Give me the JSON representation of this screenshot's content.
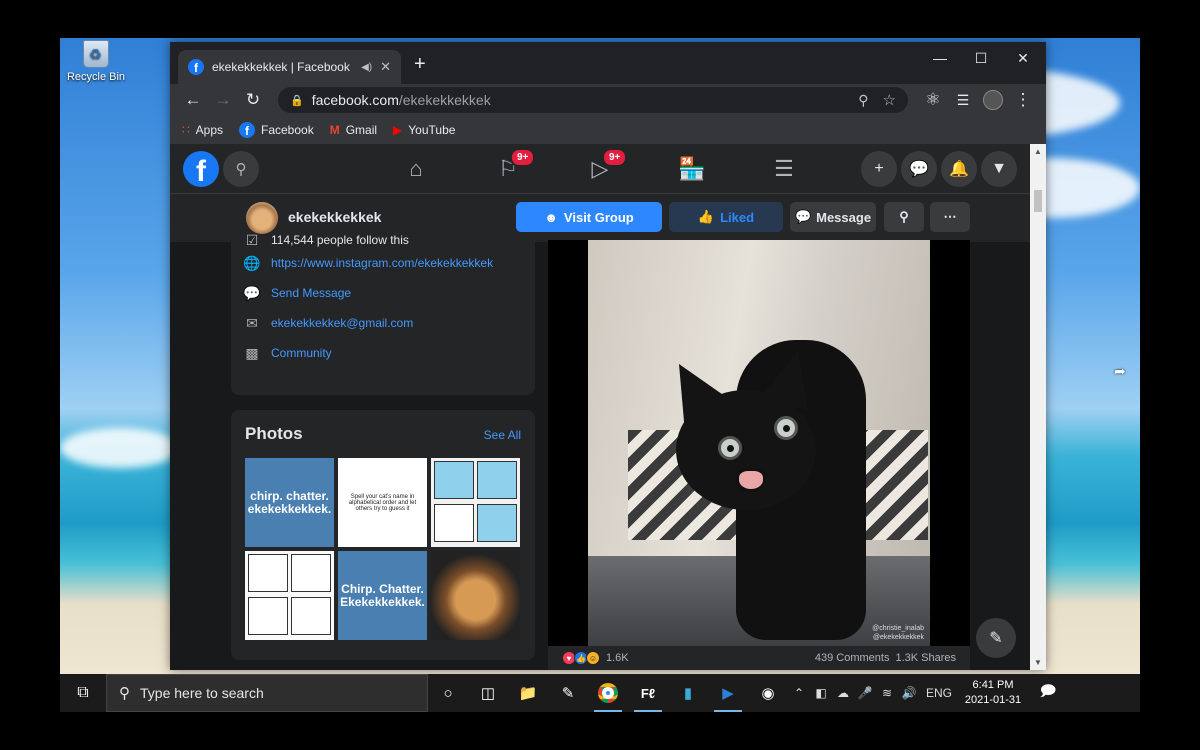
{
  "desktop": {
    "recycle_bin_label": "Recycle Bin"
  },
  "browser": {
    "tab_title": "ekekekkekkek | Facebook",
    "url_host": "facebook.com",
    "url_path": "/ekekekkekkek",
    "bookmarks": [
      {
        "label": "Apps",
        "icon": "apps-grid-icon"
      },
      {
        "label": "Facebook",
        "icon": "facebook-icon"
      },
      {
        "label": "Gmail",
        "icon": "gmail-icon"
      },
      {
        "label": "YouTube",
        "icon": "youtube-icon"
      }
    ]
  },
  "facebook": {
    "nav_badges": {
      "pages": "9+",
      "watch": "9+"
    },
    "page_name": "ekekekkekkek",
    "buttons": {
      "visit_group": "Visit Group",
      "liked": "Liked",
      "message": "Message"
    },
    "about": {
      "followers": "114,544 people follow this",
      "instagram": "https://www.instagram.com/ekekekkekkek",
      "send_message": "Send Message",
      "email": "ekekekkekkek@gmail.com",
      "category": "Community"
    },
    "photos": {
      "title": "Photos",
      "see_all": "See All",
      "tile1": "chirp. chatter. ekekekkekkek.",
      "tile2": "Spell your cat's name in alphabetical order and let others try to guess it",
      "tile5": "Chirp. Chatter. Ekekekkekkek."
    },
    "post": {
      "watermark_1": "@christie_inalab",
      "watermark_2": "@ekekekkekkek",
      "reaction_count": "1.6K",
      "comments": "439 Comments",
      "shares": "1.3K Shares"
    }
  },
  "taskbar": {
    "search_placeholder": "Type here to search",
    "language": "ENG",
    "time": "6:41 PM",
    "date": "2021-01-31"
  },
  "colors": {
    "facebook_blue": "#1877f2",
    "fb_dark_bg": "#18191a",
    "fb_card": "#242526",
    "link": "#4599ff"
  }
}
